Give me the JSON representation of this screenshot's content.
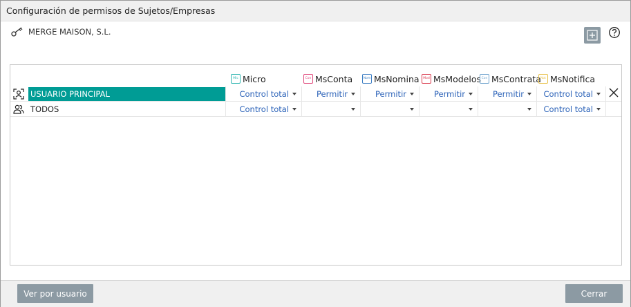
{
  "window": {
    "title": "Configuración de permisos de Sujetos/Empresas"
  },
  "company": {
    "name": "MERGE MAISON, S.L.",
    "icon": "key-icon"
  },
  "toolbar": {
    "add_icon": "plus-square-icon",
    "help_icon": "help-circle-icon"
  },
  "columns": [
    {
      "tag": "Mic",
      "label": "Micro",
      "color": "#2bb5b0"
    },
    {
      "tag": "Con",
      "label": "MsConta",
      "color": "#e0467a"
    },
    {
      "tag": "Nom",
      "label": "MsNomina",
      "color": "#3e7fc4"
    },
    {
      "tag": "Mod",
      "label": "MsModelos",
      "color": "#d9364a"
    },
    {
      "tag": "Con",
      "label": "MsContrata",
      "color": "#6aa0cc"
    },
    {
      "tag": "Not",
      "label": "MsNotifica",
      "color": "#e8c14a"
    }
  ],
  "rows": [
    {
      "name": "USUARIO PRINCIPAL",
      "icon": "user-scan-icon",
      "selected": true,
      "values": [
        "Control total",
        "Permitir",
        "Permitir",
        "Permitir",
        "Permitir",
        "Control total"
      ]
    },
    {
      "name": "TODOS",
      "icon": "users-group-icon",
      "selected": false,
      "values": [
        "Control total",
        "",
        "",
        "",
        "",
        "Control total"
      ]
    }
  ],
  "footer": {
    "left_button": "Ver por usuario",
    "right_button": "Cerrar"
  },
  "colors": {
    "selected_row": "#009c95",
    "permission_text": "#2b62b8",
    "button_bg": "#8c9aa3"
  }
}
